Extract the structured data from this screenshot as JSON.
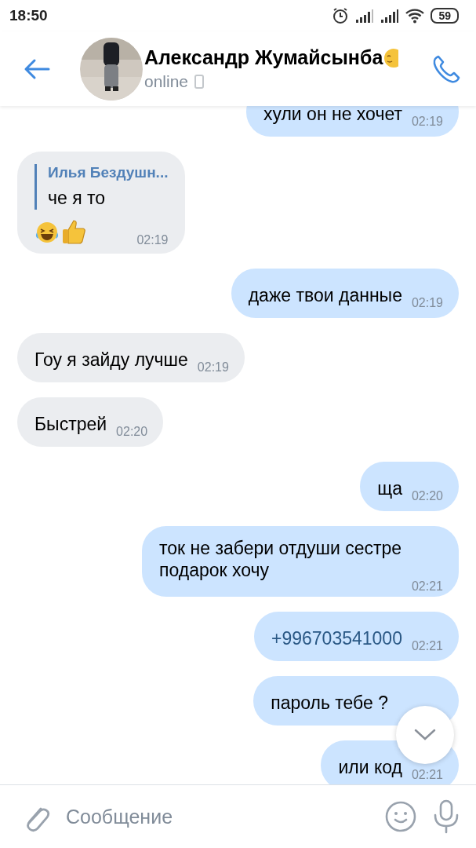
{
  "status_bar": {
    "time": "18:50",
    "battery": "59"
  },
  "header": {
    "name": "Александр Жумайсынба",
    "status": "online"
  },
  "messages": [
    {
      "kind": "text",
      "outgoing": true,
      "text": "хули он не хочет",
      "time": "02:19",
      "cut_top": true
    },
    {
      "kind": "reply",
      "outgoing": false,
      "reply_author": "Илья Бездушн...",
      "text": "че я то",
      "has_emoji": true,
      "time": "02:19"
    },
    {
      "kind": "text",
      "outgoing": true,
      "text": "даже твои данные",
      "time": "02:19"
    },
    {
      "kind": "text",
      "outgoing": false,
      "text": "Гоу я зайду лучше",
      "time": "02:19"
    },
    {
      "kind": "text",
      "outgoing": false,
      "text": "Быстрей",
      "time": "02:20"
    },
    {
      "kind": "text",
      "outgoing": true,
      "text": "ща",
      "time": "02:20"
    },
    {
      "kind": "text",
      "outgoing": true,
      "text": "ток не забери отдуши сестре подарок хочу",
      "time": "02:21",
      "wide": true
    },
    {
      "kind": "phone",
      "outgoing": true,
      "text": "+996703541000",
      "time": "02:21"
    },
    {
      "kind": "text",
      "outgoing": true,
      "text": "пароль тебе ?"
    },
    {
      "kind": "text",
      "outgoing": true,
      "text": "или код",
      "time": "02:21"
    }
  ],
  "composer": {
    "placeholder": "Сообщение"
  }
}
